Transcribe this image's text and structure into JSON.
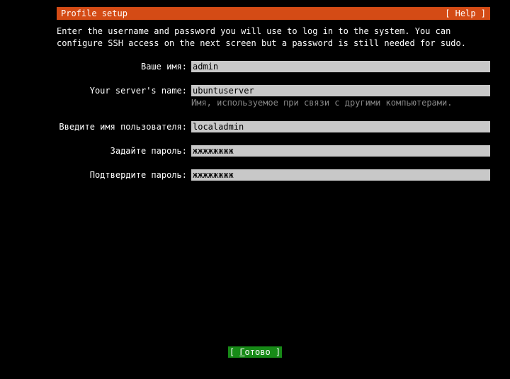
{
  "header": {
    "title": "Profile setup",
    "help": "[ Help ]"
  },
  "description": "Enter the username and password you will use to log in to the system. You can configure SSH access on the next screen but a password is still needed for sudo.",
  "fields": {
    "name": {
      "label": "Ваше имя:",
      "value": "admin"
    },
    "server": {
      "label": "Your server's name:",
      "value": "ubuntuserver",
      "hint": "Имя, используемое при связи с другими компьютерами."
    },
    "username": {
      "label": "Введите имя пользователя:",
      "value": "localadmin"
    },
    "password": {
      "label": "Задайте пароль:",
      "value": "жжжжжжжж"
    },
    "confirm": {
      "label": "Подтвердите пароль:",
      "value": "жжжжжжжж"
    }
  },
  "footer": {
    "done_prefix": "[ ",
    "done_key": "Г",
    "done_rest": "отово   ]"
  }
}
